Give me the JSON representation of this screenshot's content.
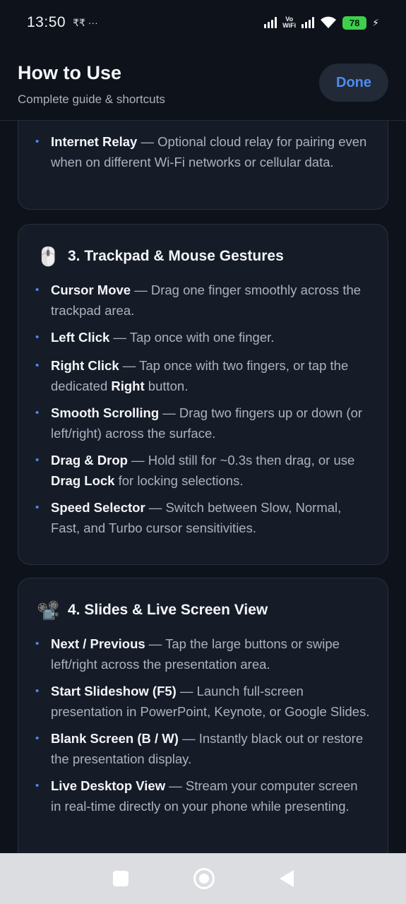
{
  "status": {
    "time": "13:50",
    "misc": "₹₹ ···",
    "vowifi_top": "Vo",
    "vowifi_bottom": "WiFi",
    "battery": "78"
  },
  "header": {
    "title": "How to Use",
    "subtitle": "Complete guide & shortcuts",
    "done_label": "Done"
  },
  "cards": [
    {
      "items": [
        {
          "term": "Internet Relay",
          "text": " — Optional cloud relay for pairing even when on different Wi-Fi networks or cellular data."
        }
      ]
    },
    {
      "icon": "🖱️",
      "title": "3. Trackpad & Mouse Gestures",
      "items": [
        {
          "term": "Cursor Move",
          "text": " — Drag one finger smoothly across the trackpad area."
        },
        {
          "term": "Left Click",
          "text": " — Tap once with one finger."
        },
        {
          "term": "Right Click",
          "text": " — Tap once with two fingers, or tap the dedicated ",
          "em": "Right",
          "tail": " button."
        },
        {
          "term": "Smooth Scrolling",
          "text": " — Drag two fingers up or down (or left/right) across the surface."
        },
        {
          "term": "Drag & Drop",
          "text": " — Hold still for ~0.3s then drag, or use ",
          "em": "Drag Lock",
          "tail": " for locking selections."
        },
        {
          "term": "Speed Selector",
          "text": " — Switch between Slow, Normal, Fast, and Turbo cursor sensitivities."
        }
      ]
    },
    {
      "icon": "📽️",
      "title": "4. Slides & Live Screen View",
      "items": [
        {
          "term": "Next / Previous",
          "text": " — Tap the large buttons or swipe left/right across the presentation area."
        },
        {
          "term": "Start Slideshow (F5)",
          "text": " — Launch full-screen presentation in PowerPoint, Keynote, or Google Slides."
        },
        {
          "term": "Blank Screen (B / W)",
          "text": " — Instantly black out or restore the presentation display."
        },
        {
          "term": "Live Desktop View",
          "text": " — Stream your computer screen in real-time directly on your phone while presenting."
        }
      ]
    }
  ]
}
